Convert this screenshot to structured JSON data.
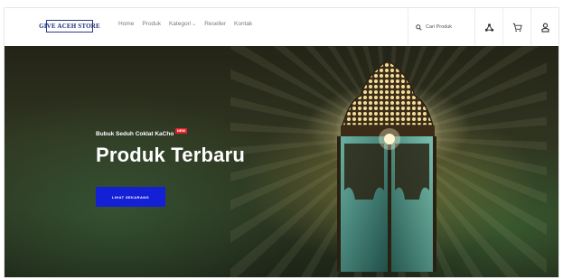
{
  "header": {
    "logo_text": "GIVE ACEH STORE",
    "nav": [
      {
        "label": "Home"
      },
      {
        "label": "Produk"
      },
      {
        "label": "Kategori",
        "has_dropdown": true,
        "dropdown_icon": "chevron-down-icon"
      },
      {
        "label": "Reseller"
      },
      {
        "label": "Kontak"
      }
    ],
    "search": {
      "placeholder": "Cari Produk",
      "icon": "search-icon"
    },
    "icons": [
      "network-icon",
      "cart-icon",
      "user-icon"
    ]
  },
  "hero": {
    "subtitle": "Bubuk Seduh Coklat KaCho",
    "badge": "NEW",
    "title": "Produk Terbaru",
    "cta_label": "LIHAT SEKARANG",
    "image": "lantern"
  },
  "colors": {
    "cta": "#1420d6",
    "badge": "#e5232b",
    "logo": "#1f2f7a"
  }
}
